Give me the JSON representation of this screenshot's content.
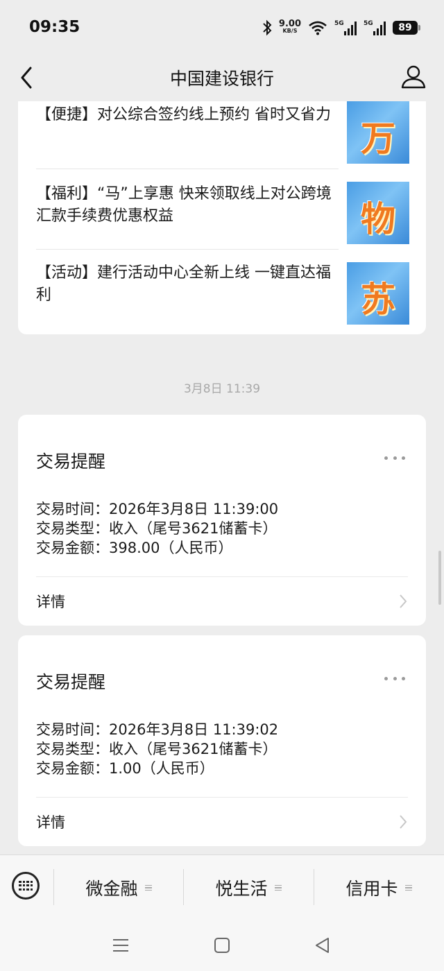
{
  "status_bar": {
    "time": "09:35",
    "net_speed_value": "9.00",
    "net_speed_unit": "KB/S",
    "signal1_label": "5G",
    "signal2_label": "5G",
    "battery": "89",
    "icons": [
      "bluetooth-icon",
      "wifi-icon",
      "signal-icon",
      "signal-icon",
      "battery-icon"
    ]
  },
  "header": {
    "title": "中国建设银行",
    "back_icon": "chevron-left-icon",
    "profile_icon": "person-icon"
  },
  "articles": [
    {
      "title": "【便捷】对公综合签约线上预约 省时又省力",
      "thumb_char": "万"
    },
    {
      "title": "【福利】“马”上享惠 快来领取线上对公跨境汇款手续费优惠权益",
      "thumb_char": "物"
    },
    {
      "title": "【活动】建行活动中心全新上线 一键直达福利",
      "thumb_char": "苏"
    }
  ],
  "timestamp": "3月8日 11:39",
  "transactions": [
    {
      "title": "交易提醒",
      "time_label": "交易时间：",
      "time_value": "2026年3月8日 11:39:00",
      "type_label": "交易类型：",
      "type_value": "收入（尾号3621储蓄卡）",
      "amount_label": "交易金额：",
      "amount_value": "398.00（人民币）",
      "detail": "详情"
    },
    {
      "title": "交易提醒",
      "time_label": "交易时间：",
      "time_value": "2026年3月8日 11:39:02",
      "type_label": "交易类型：",
      "type_value": "收入（尾号3621储蓄卡）",
      "amount_label": "交易金额：",
      "amount_value": "1.00（人民币）",
      "detail": "详情"
    }
  ],
  "bottom_menu": {
    "items": [
      "微金融",
      "悦生活",
      "信用卡"
    ]
  },
  "colors": {
    "background": "#ededed",
    "card": "#ffffff",
    "thumb_blue": "#4a9de4",
    "thumb_text": "#f07a20"
  }
}
